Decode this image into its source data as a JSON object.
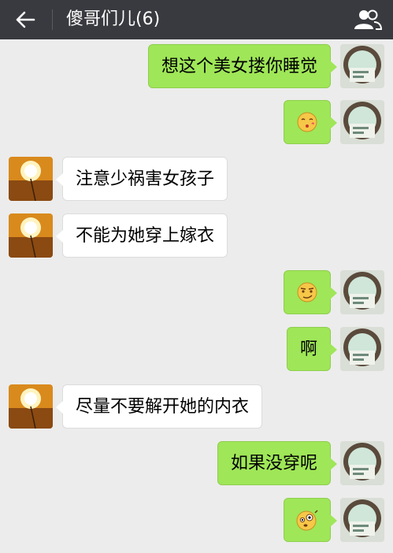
{
  "header": {
    "title": "傻哥们儿(6)",
    "back_icon": "arrow-left-icon",
    "group_icon": "group-members-icon"
  },
  "colors": {
    "header_bg": "#393a3f",
    "chat_bg": "#ececec",
    "mine_bubble": "#9fe658",
    "theirs_bubble": "#ffffff"
  },
  "messages": [
    {
      "side": "mine",
      "type": "text",
      "text": "想这个美女搂你睡觉"
    },
    {
      "side": "mine",
      "type": "emoji",
      "emoji": "kissing-face-emoji"
    },
    {
      "side": "theirs",
      "type": "text",
      "text": "注意少祸害女孩子"
    },
    {
      "side": "theirs",
      "type": "text",
      "text": "不能为她穿上嫁衣"
    },
    {
      "side": "mine",
      "type": "emoji",
      "emoji": "smirking-face-emoji"
    },
    {
      "side": "mine",
      "type": "text",
      "text": "啊"
    },
    {
      "side": "theirs",
      "type": "text",
      "text": "尽量不要解开她的内衣"
    },
    {
      "side": "mine",
      "type": "text",
      "text": "如果没穿呢"
    },
    {
      "side": "mine",
      "type": "emoji",
      "emoji": "shocked-face-emoji"
    }
  ]
}
